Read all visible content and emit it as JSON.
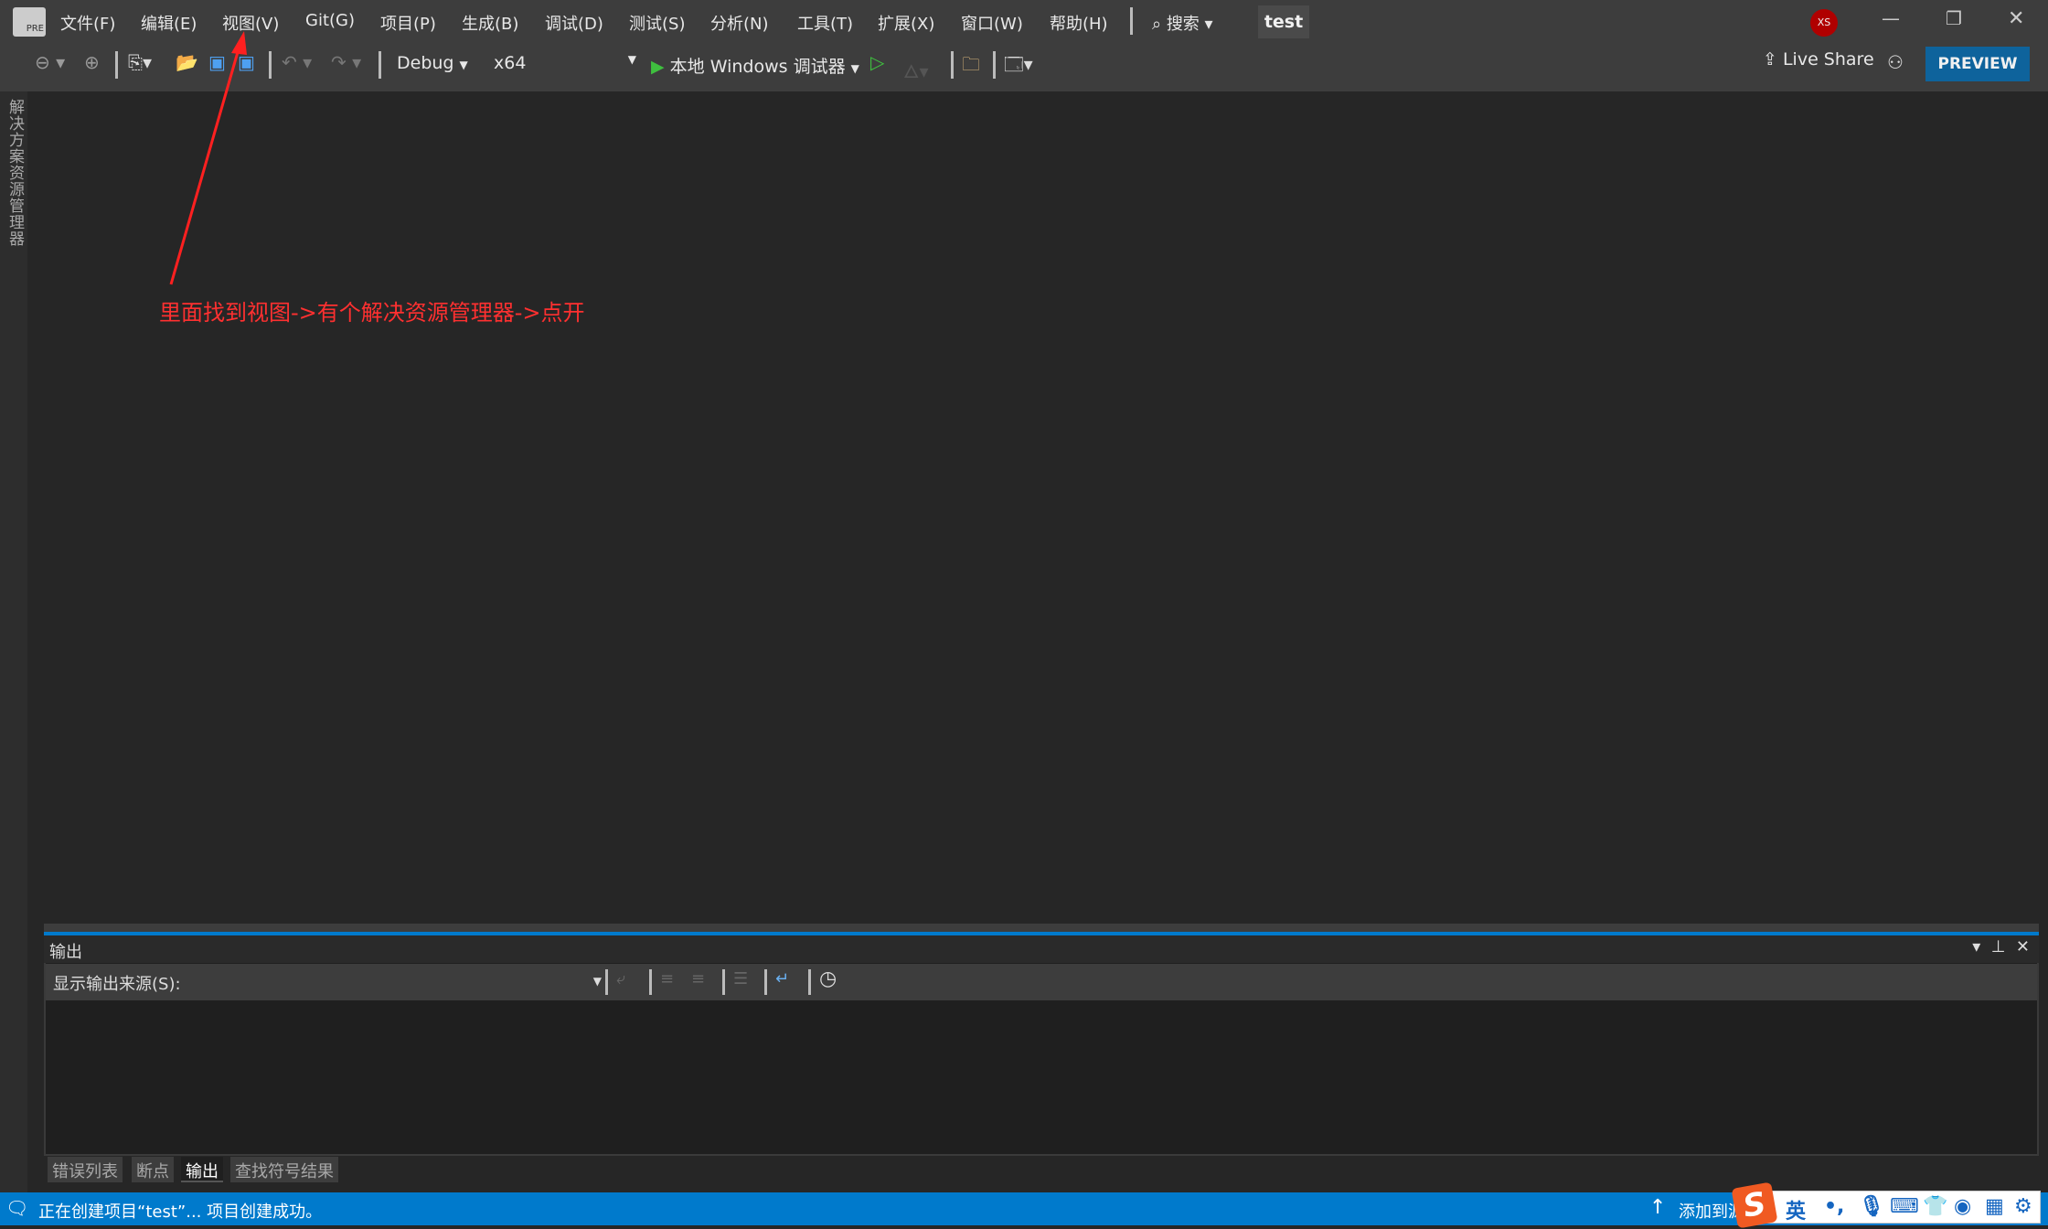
{
  "titlebar": {
    "menu": [
      "文件(F)",
      "编辑(E)",
      "视图(V)",
      "Git(G)",
      "项目(P)",
      "生成(B)",
      "调试(D)",
      "测试(S)",
      "分析(N)",
      "工具(T)",
      "扩展(X)",
      "窗口(W)",
      "帮助(H)"
    ],
    "search": "搜索",
    "solution": "test",
    "avatar": "XS",
    "logo": "PRE"
  },
  "toolbar": {
    "config": "Debug",
    "platform": "x64",
    "run": "本地 Windows 调试器",
    "live_share": "Live Share",
    "preview": "PREVIEW"
  },
  "sidebar": {
    "solution_explorer": "解决方案资源管理器"
  },
  "annotation": {
    "text": "里面找到视图->有个解决资源管理器->点开",
    "color": "#ff3030"
  },
  "output": {
    "title": "输出",
    "source_label": "显示输出来源(S):",
    "tabs": [
      "错误列表",
      "断点",
      "输出",
      "查找符号结果"
    ],
    "active_tab": "输出"
  },
  "status": {
    "message": "正在创建项目“test”... 项目创建成功。",
    "add_source": "添加到源"
  },
  "ime": {
    "mode": "英",
    "punct": "•,"
  },
  "colors": {
    "accent": "#007acc",
    "preview": "#0e639c",
    "avatar": "#b00000"
  }
}
